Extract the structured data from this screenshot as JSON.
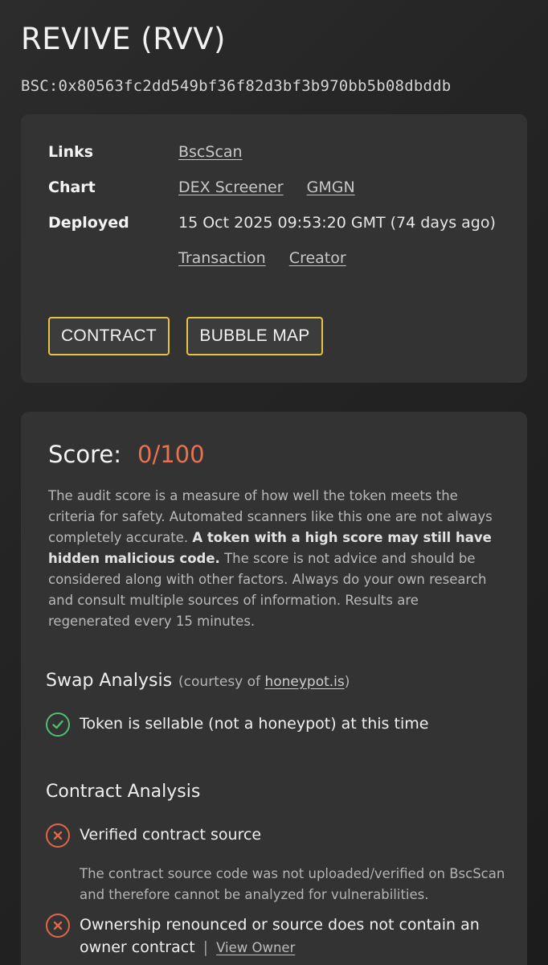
{
  "header": {
    "title": "REVIVE (RVV)",
    "address": "BSC:0x80563fc2dd549bf36f82d3bf3b970bb5b08dbddb"
  },
  "links_card": {
    "links_label": "Links",
    "links": [
      "BscScan"
    ],
    "chart_label": "Chart",
    "charts": [
      "DEX Screener",
      "GMGN"
    ],
    "deployed_label": "Deployed",
    "deployed_value": "15 Oct 2025 09:53:20 GMT (74 days ago)",
    "deploy_links": [
      "Transaction",
      "Creator"
    ],
    "buttons": [
      "CONTRACT",
      "BUBBLE MAP"
    ]
  },
  "score_card": {
    "score_label": "Score:",
    "score_value": "0/100",
    "desc_part1": "The audit score is a measure of how well the token meets the criteria for safety. Automated scanners like this one are not always completely accurate.",
    "desc_bold": "A token with a high score may still have hidden malicious code.",
    "desc_part2": "The score is not advice and should be considered along with other factors. Always do your own research and consult multiple sources of information. Results are regenerated every 15 minutes.",
    "swap_title": "Swap Analysis",
    "courtesy_prefix": "(courtesy of",
    "courtesy_link": "honeypot.is",
    "courtesy_suffix": ")",
    "swap_result": "Token is sellable (not a honeypot) at this time",
    "contract_title": "Contract Analysis",
    "verified_label": "Verified contract source",
    "verified_note": "The contract source code was not uploaded/verified on BscScan and therefore cannot be analyzed for vulnerabilities.",
    "ownership_label": "Ownership renounced or source does not contain an owner contract",
    "pipe": "|",
    "view_owner": "View Owner"
  },
  "colors": {
    "accent_button": "#e9c23f",
    "score_bad": "#e8724f",
    "ok_green": "#4fc06d",
    "fail_red": "#e0664a"
  }
}
